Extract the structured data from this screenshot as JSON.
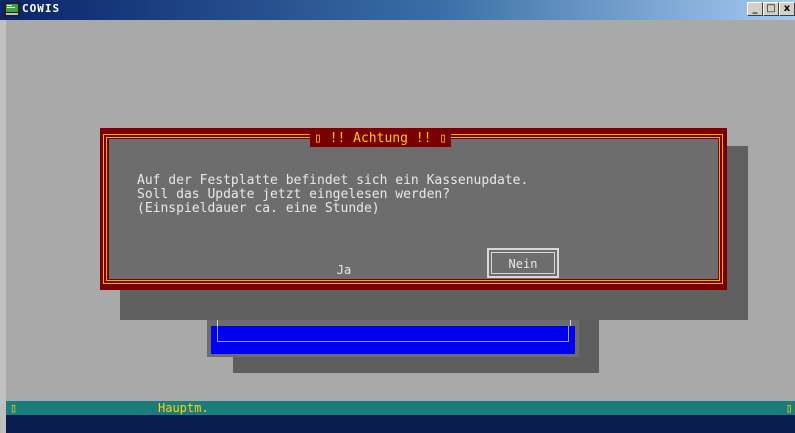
{
  "window": {
    "title": "COWIS",
    "minimize": "_",
    "maximize": "□",
    "close": "x"
  },
  "dialog": {
    "title": "▯ !! Achtung !! ▯",
    "message": "Auf der Festplatte befindet sich ein Kassenupdate.\nSoll das Update jetzt eingelesen werden?\n(Einspieldauer ca. eine Stunde)",
    "yes_label": "Ja",
    "no_label": "Nein"
  },
  "status_bar": {
    "left": "▯",
    "label": "Hauptm.",
    "right": "▯"
  },
  "colors": {
    "dialog_frame": "#7a0000",
    "dialog_border": "#e6b400",
    "status_bg": "#1c7b7b",
    "status_fg": "#ffd400",
    "menu_bar": "#0000f0"
  }
}
